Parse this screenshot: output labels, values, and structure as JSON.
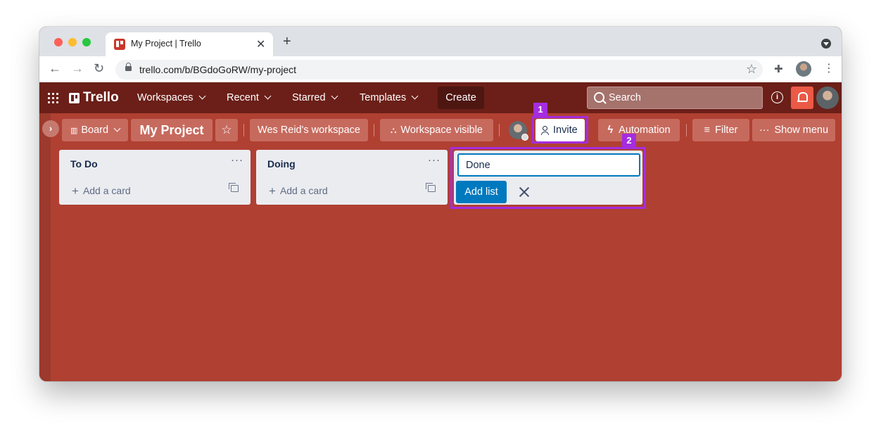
{
  "browser": {
    "tab_title": "My Project | Trello",
    "tab_close": "✕",
    "new_tab": "+",
    "url": "trello.com/b/BGdoGoRW/my-project",
    "nav": {
      "back": "←",
      "forward": "→",
      "reload": "↻"
    },
    "bookmark_star": "☆",
    "menu": "⋮",
    "extensions": "✚"
  },
  "header": {
    "logo": "Trello",
    "workspaces": "Workspaces",
    "recent": "Recent",
    "starred": "Starred",
    "templates": "Templates",
    "create": "Create",
    "search_placeholder": "Search",
    "info": "i"
  },
  "board": {
    "sidebar_toggle": "›",
    "view": "Board",
    "name": "My Project",
    "star": "☆",
    "workspace": "Wes Reid's workspace",
    "visibility": "Workspace visible",
    "invite": "Invite",
    "automation": "Automation",
    "filter": "Filter",
    "show_menu": "Show menu"
  },
  "lists": [
    {
      "title": "To Do",
      "menu": "···",
      "add_card": "Add a card",
      "plus": "+"
    },
    {
      "title": "Doing",
      "menu": "···",
      "add_card": "Add a card",
      "plus": "+"
    }
  ],
  "add_list": {
    "input_value": "Done",
    "button": "Add list"
  },
  "annotations": [
    "1",
    "2"
  ],
  "colors": {
    "board_bg": "#b04032",
    "header_bg": "#6b1f18",
    "highlight": "#a52ce0",
    "primary_button": "#0079bf",
    "notification": "#eb5a46"
  }
}
